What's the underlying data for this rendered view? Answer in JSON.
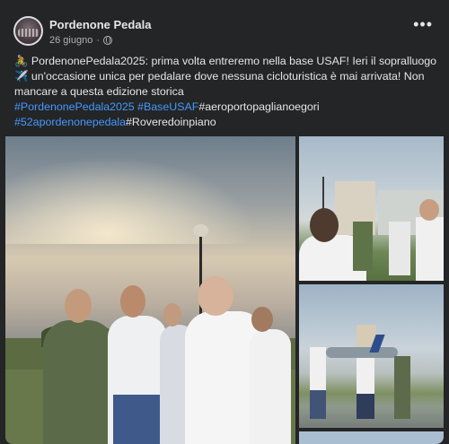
{
  "post": {
    "page_name": "Pordenone Pedala",
    "date": "26 giugno",
    "date_separator": "·",
    "more_label": "•••",
    "text_line1": "🚴 PordenonePedala2025: prima volta entreremo nella base USAF! Ieri il sopralluogo",
    "text_line2": "✈️ un'occasione unica per pedalare dove nessuna cicloturistica è mai arrivata! Non",
    "text_line3": "mancare a questa edizione storica",
    "hashtag1": "#PordenonePedala2025",
    "hashtag2": "#BaseUSAF",
    "hashtag3": "#aeroportopaglianoegori",
    "hashtag4": "#52apordenonepedala",
    "hashtag5": "#Roveredoinpiano"
  },
  "colors": {
    "background": "#242526",
    "text": "#e4e6eb",
    "secondary_text": "#b0b3b8",
    "link": "#4599ff"
  },
  "icons": {
    "audience": "globe-icon",
    "menu": "more-options-icon"
  }
}
